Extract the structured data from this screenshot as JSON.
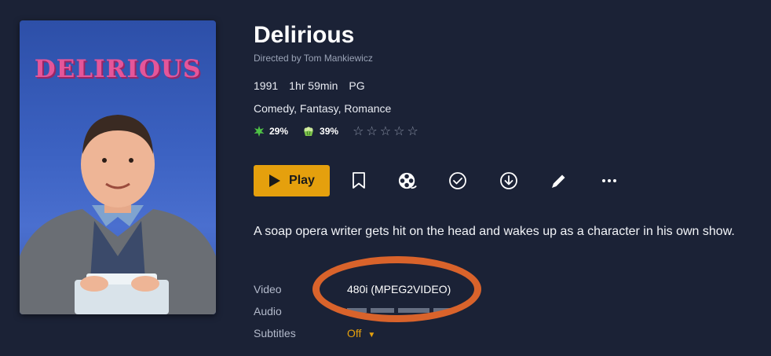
{
  "poster": {
    "title_text": "DELIRIOUS"
  },
  "movie": {
    "title": "Delirious",
    "director": "Directed by Tom Mankiewicz",
    "year": "1991",
    "runtime": "1hr 59min",
    "rating": "PG",
    "genres": "Comedy, Fantasy, Romance",
    "critic_score": "29%",
    "audience_score": "39%",
    "user_stars": 0,
    "summary": "A soap opera writer gets hit on the head and wakes up as a character in his own show."
  },
  "actions": {
    "play_label": "Play",
    "icons": [
      "bookmark-icon",
      "trailer-reel-icon",
      "mark-watched-icon",
      "download-icon",
      "edit-icon",
      "more-icon"
    ]
  },
  "media_info": {
    "video_label": "Video",
    "video_value": "480i (MPEG2VIDEO)",
    "audio_label": "Audio",
    "subtitles_label": "Subtitles",
    "subtitles_value": "Off"
  },
  "colors": {
    "accent": "#e5a00d",
    "background": "#1b2236",
    "annotation": "#d9632b",
    "critic_icon": "#4fc246",
    "audience_icon": "#7bc24a"
  }
}
